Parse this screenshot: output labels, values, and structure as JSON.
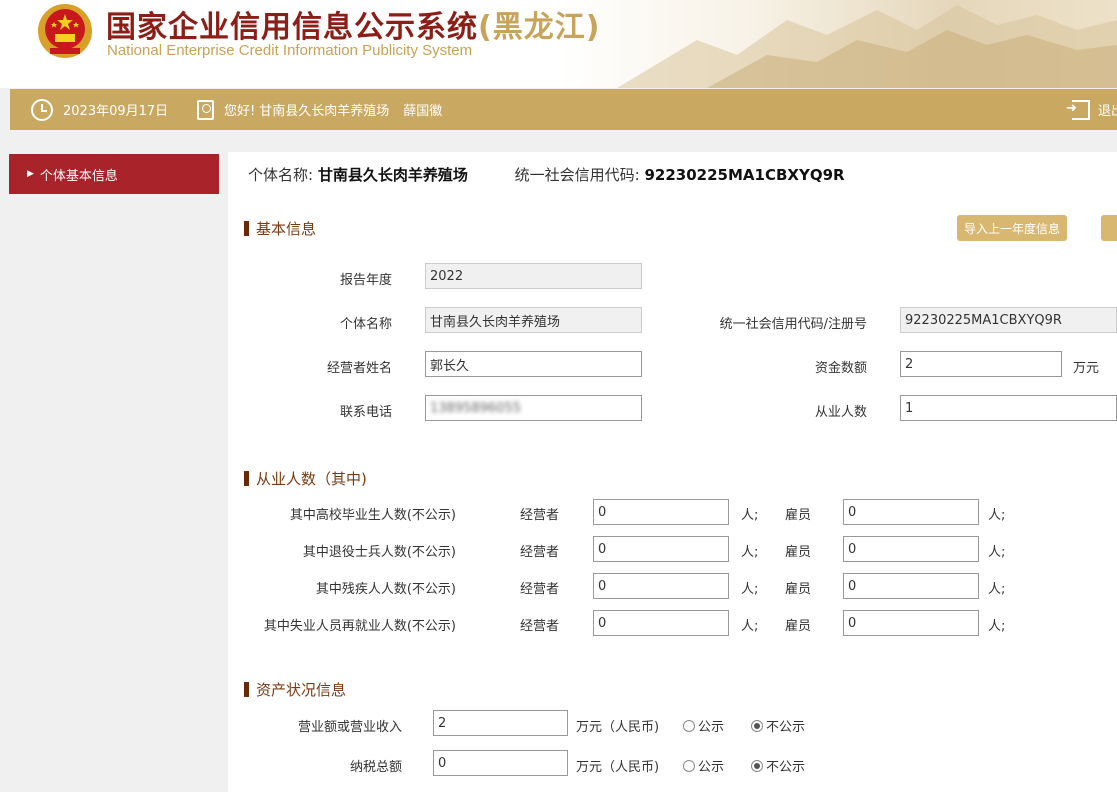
{
  "header": {
    "title_cn": "国家企业信用信息公示系统",
    "province": "(黑龙江)",
    "title_en": "National Enterprise Credit Information Publicity System"
  },
  "topbar": {
    "date": "2023年09月17日",
    "greeting": "您好!",
    "company": "甘南县久长肉羊养殖场",
    "user": "薛国徽",
    "logout": "退出"
  },
  "sidebar": {
    "items": [
      {
        "label": "个体基本信息",
        "active": true
      }
    ]
  },
  "main": {
    "entity_name_label": "个体名称:",
    "entity_name": "甘南县久长肉羊养殖场",
    "credit_code_label": "统一社会信用代码:",
    "credit_code": "92230225MA1CBXYQ9R",
    "import_button": "导入上一年度信息"
  },
  "basic": {
    "section_title": "基本信息",
    "year_label": "报告年度",
    "year": "2022",
    "name_label": "个体名称",
    "name": "甘南县久长肉羊养殖场",
    "code_label": "统一社会信用代码/注册号",
    "code": "92230225MA1CBXYQ9R",
    "operator_label": "经营者姓名",
    "operator": "郭长久",
    "capital_label": "资金数额",
    "capital": "2",
    "capital_unit": "万元",
    "phone_label": "联系电话",
    "phone": "13895896055",
    "employees_label": "从业人数",
    "employees": "1"
  },
  "staff": {
    "section_title": "从业人数（其中)",
    "col_operator": "经营者",
    "col_employee": "雇员",
    "unit": "人;",
    "rows": [
      {
        "label": "其中高校毕业生人数(不公示)",
        "operator": "0",
        "employee": "0"
      },
      {
        "label": "其中退役士兵人数(不公示)",
        "operator": "0",
        "employee": "0"
      },
      {
        "label": "其中残疾人人数(不公示)",
        "operator": "0",
        "employee": "0"
      },
      {
        "label": "其中失业人员再就业人数(不公示)",
        "operator": "0",
        "employee": "0"
      }
    ]
  },
  "assets": {
    "section_title": "资产状况信息",
    "unit": "万元（人民币)",
    "opt_public": "公示",
    "opt_private": "不公示",
    "rows": [
      {
        "label": "营业额或营业收入",
        "value": "2",
        "selected": "不公示"
      },
      {
        "label": "纳税总额",
        "value": "0",
        "selected": "不公示"
      }
    ]
  },
  "colors": {
    "gold": "#c9a962",
    "red": "#a8232a",
    "title_red": "#8b1e16"
  }
}
